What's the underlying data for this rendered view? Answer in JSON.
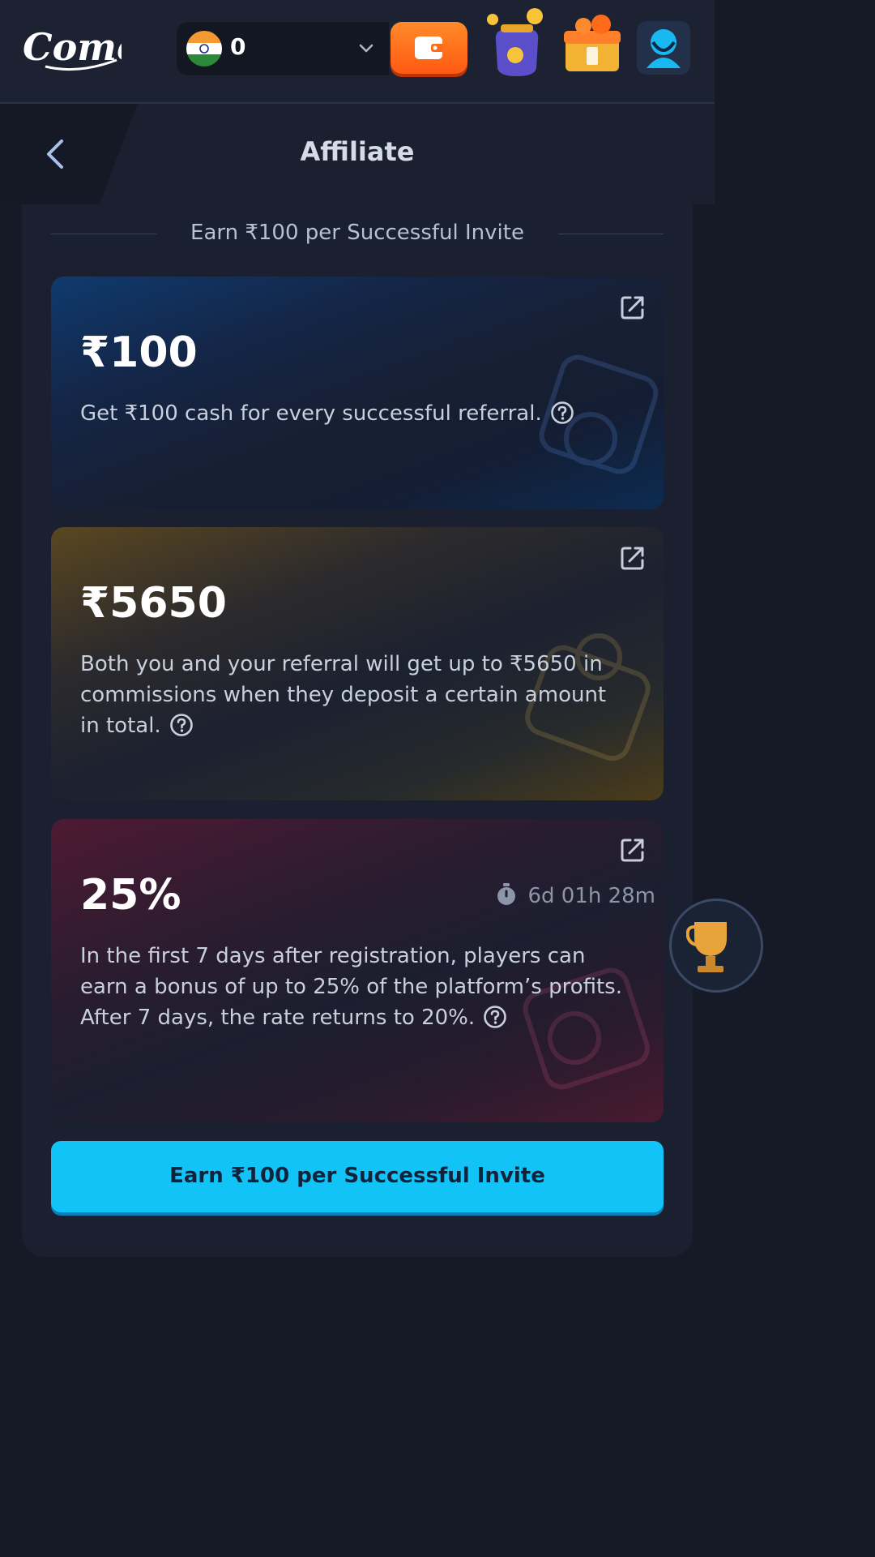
{
  "header": {
    "logo_text": "Come",
    "balance": "0",
    "currency_flag": "india-flag-icon"
  },
  "page": {
    "title": "Affiliate"
  },
  "divider": {
    "text": "Earn ₹100 per Successful Invite"
  },
  "cards": [
    {
      "amount": "₹100",
      "description": "Get ₹100 cash for every successful referral.",
      "accent": "#0f3a6e"
    },
    {
      "amount": "₹5650",
      "description": "Both you and your referral will get up to ₹5650 in commissions when they deposit a certain amount in total.",
      "accent": "#5a4720"
    },
    {
      "amount": "25%",
      "timer": "6d 01h 28m",
      "description": "In the first 7 days after registration, players can earn a bonus of up to 25% of the platform’s profits. After 7 days, the rate returns to 20%.",
      "accent": "#4e1a33"
    }
  ],
  "cta": {
    "label": "Earn ₹100 per Successful Invite",
    "color": "#11c3f6"
  },
  "colors": {
    "wallet": "#ff6a1a",
    "background": "#151a26"
  }
}
